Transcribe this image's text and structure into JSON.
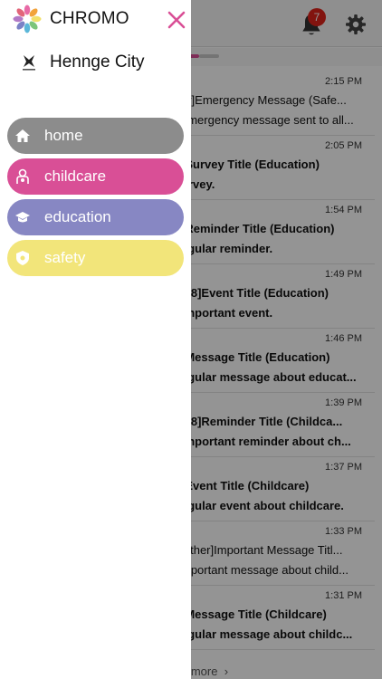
{
  "app": {
    "notification_count": "7",
    "messages": [
      {
        "time": "2:15 PM",
        "title": "er]Emergency Message (Safe...",
        "desc": "emergency message sent to all...",
        "bold": false
      },
      {
        "time": "2:05 PM",
        "title": "]Survey Title (Education)",
        "desc": "urvey.",
        "bold": true
      },
      {
        "time": "1:54 PM",
        "title": "]Reminder Title (Education)",
        "desc": "egular reminder.",
        "bold": true
      },
      {
        "time": "1:49 PM",
        "title": "/28]Event Title (Education)",
        "desc": "important event.",
        "bold": true
      },
      {
        "time": "1:46 PM",
        "title": "]Message Title (Education)",
        "desc": "egular message about educat...",
        "bold": true
      },
      {
        "time": "1:39 PM",
        "title": "/28]Reminder Title (Childca...",
        "desc": "important reminder about ch...",
        "bold": true
      },
      {
        "time": "1:37 PM",
        "title": "]Event Title (Childcare)",
        "desc": "egular event about childcare.",
        "bold": true
      },
      {
        "time": "1:33 PM",
        "title": "Other]Important Message Titl...",
        "desc": "mportant message about child...",
        "bold": false
      },
      {
        "time": "1:31 PM",
        "title": "]Message Title (Childcare)",
        "desc": "egular message about childc...",
        "bold": true
      }
    ],
    "more_label": "d more"
  },
  "drawer": {
    "brand_name": "CHROMO",
    "city_name": "Hennge City",
    "menu": [
      {
        "label": "home",
        "icon": "home-icon",
        "color": "#8c8c8c"
      },
      {
        "label": "childcare",
        "icon": "childcare-icon",
        "color": "#d94f96"
      },
      {
        "label": "education",
        "icon": "graduation-cap-icon",
        "color": "#8787c3"
      },
      {
        "label": "safety",
        "icon": "shield-icon",
        "color": "#f2e57a"
      }
    ]
  }
}
